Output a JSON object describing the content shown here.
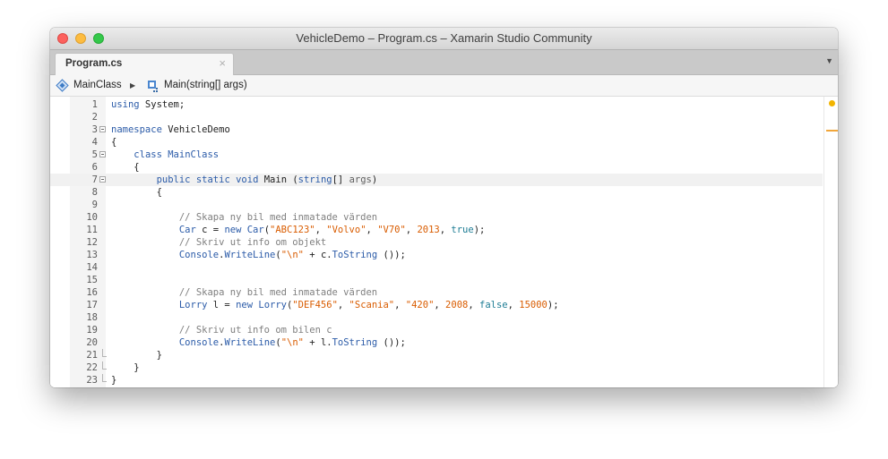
{
  "window": {
    "title": "VehicleDemo – Program.cs – Xamarin Studio Community"
  },
  "tabs": [
    {
      "label": "Program.cs",
      "close": "×"
    }
  ],
  "tab_dropdown": "▼",
  "breadcrumb": {
    "class_name": "MainClass",
    "separator": "▶",
    "method_name": "Main(string[] args)"
  },
  "editor": {
    "current_line": 7,
    "lines": [
      {
        "n": "1",
        "fold": "",
        "tokens": [
          [
            "kw",
            "using"
          ],
          [
            "t",
            " System;"
          ]
        ]
      },
      {
        "n": "2",
        "fold": "",
        "tokens": []
      },
      {
        "n": "3",
        "fold": "start",
        "tokens": [
          [
            "kw",
            "namespace"
          ],
          [
            "t",
            " VehicleDemo"
          ]
        ]
      },
      {
        "n": "4",
        "fold": "",
        "tokens": [
          [
            "t",
            "{"
          ]
        ]
      },
      {
        "n": "5",
        "fold": "start",
        "tokens": [
          [
            "t",
            "    "
          ],
          [
            "kw",
            "class"
          ],
          [
            "t",
            " "
          ],
          [
            "ty",
            "MainClass"
          ]
        ]
      },
      {
        "n": "6",
        "fold": "",
        "tokens": [
          [
            "t",
            "    {"
          ]
        ]
      },
      {
        "n": "7",
        "fold": "start",
        "tokens": [
          [
            "t",
            "        "
          ],
          [
            "kw",
            "public"
          ],
          [
            "t",
            " "
          ],
          [
            "kw",
            "static"
          ],
          [
            "t",
            " "
          ],
          [
            "kw",
            "void"
          ],
          [
            "t",
            " Main ("
          ],
          [
            "kw",
            "string"
          ],
          [
            "t",
            "[] "
          ],
          [
            "prm",
            "args"
          ],
          [
            "t",
            ")"
          ]
        ]
      },
      {
        "n": "8",
        "fold": "",
        "tokens": [
          [
            "t",
            "        {"
          ]
        ]
      },
      {
        "n": "9",
        "fold": "",
        "tokens": []
      },
      {
        "n": "10",
        "fold": "",
        "tokens": [
          [
            "t",
            "            "
          ],
          [
            "com",
            "// Skapa ny bil med inmatade värden"
          ]
        ]
      },
      {
        "n": "11",
        "fold": "",
        "tokens": [
          [
            "t",
            "            "
          ],
          [
            "ty",
            "Car"
          ],
          [
            "t",
            " c = "
          ],
          [
            "kw",
            "new"
          ],
          [
            "t",
            " "
          ],
          [
            "ty",
            "Car"
          ],
          [
            "t",
            "("
          ],
          [
            "str",
            "\"ABC123\""
          ],
          [
            "t",
            ", "
          ],
          [
            "str",
            "\"Volvo\""
          ],
          [
            "t",
            ", "
          ],
          [
            "str",
            "\"V70\""
          ],
          [
            "t",
            ", "
          ],
          [
            "num",
            "2013"
          ],
          [
            "t",
            ", "
          ],
          [
            "bool",
            "true"
          ],
          [
            "t",
            ");"
          ]
        ]
      },
      {
        "n": "12",
        "fold": "",
        "tokens": [
          [
            "t",
            "            "
          ],
          [
            "com",
            "// Skriv ut info om objekt"
          ]
        ]
      },
      {
        "n": "13",
        "fold": "",
        "tokens": [
          [
            "t",
            "            "
          ],
          [
            "ty",
            "Console"
          ],
          [
            "t",
            "."
          ],
          [
            "ty",
            "WriteLine"
          ],
          [
            "t",
            "("
          ],
          [
            "str",
            "\"\\n\""
          ],
          [
            "t",
            " + c."
          ],
          [
            "ty",
            "ToString"
          ],
          [
            "t",
            " ());"
          ]
        ]
      },
      {
        "n": "14",
        "fold": "",
        "tokens": []
      },
      {
        "n": "15",
        "fold": "",
        "tokens": []
      },
      {
        "n": "16",
        "fold": "",
        "tokens": [
          [
            "t",
            "            "
          ],
          [
            "com",
            "// Skapa ny bil med inmatade värden"
          ]
        ]
      },
      {
        "n": "17",
        "fold": "",
        "tokens": [
          [
            "t",
            "            "
          ],
          [
            "ty",
            "Lorry"
          ],
          [
            "t",
            " l = "
          ],
          [
            "kw",
            "new"
          ],
          [
            "t",
            " "
          ],
          [
            "ty",
            "Lorry"
          ],
          [
            "t",
            "("
          ],
          [
            "str",
            "\"DEF456\""
          ],
          [
            "t",
            ", "
          ],
          [
            "str",
            "\"Scania\""
          ],
          [
            "t",
            ", "
          ],
          [
            "str",
            "\"420\""
          ],
          [
            "t",
            ", "
          ],
          [
            "num",
            "2008"
          ],
          [
            "t",
            ", "
          ],
          [
            "bool",
            "false"
          ],
          [
            "t",
            ", "
          ],
          [
            "num",
            "15000"
          ],
          [
            "t",
            ");"
          ]
        ]
      },
      {
        "n": "18",
        "fold": "",
        "tokens": []
      },
      {
        "n": "19",
        "fold": "",
        "tokens": [
          [
            "t",
            "            "
          ],
          [
            "com",
            "// Skriv ut info om bilen c"
          ]
        ]
      },
      {
        "n": "20",
        "fold": "",
        "tokens": [
          [
            "t",
            "            "
          ],
          [
            "ty",
            "Console"
          ],
          [
            "t",
            "."
          ],
          [
            "ty",
            "WriteLine"
          ],
          [
            "t",
            "("
          ],
          [
            "str",
            "\"\\n\""
          ],
          [
            "t",
            " + l."
          ],
          [
            "ty",
            "ToString"
          ],
          [
            "t",
            " ());"
          ]
        ]
      },
      {
        "n": "21",
        "fold": "end",
        "tokens": [
          [
            "t",
            "        }"
          ]
        ]
      },
      {
        "n": "22",
        "fold": "end",
        "tokens": [
          [
            "t",
            "    }"
          ]
        ]
      },
      {
        "n": "23",
        "fold": "end",
        "tokens": [
          [
            "t",
            "}"
          ]
        ]
      }
    ]
  },
  "colors": {
    "keyword": "#2b5ba8",
    "string": "#d95c00",
    "comment": "#7f7f7f",
    "bool": "#1d7c94",
    "warning_dot": "#f2b400"
  }
}
